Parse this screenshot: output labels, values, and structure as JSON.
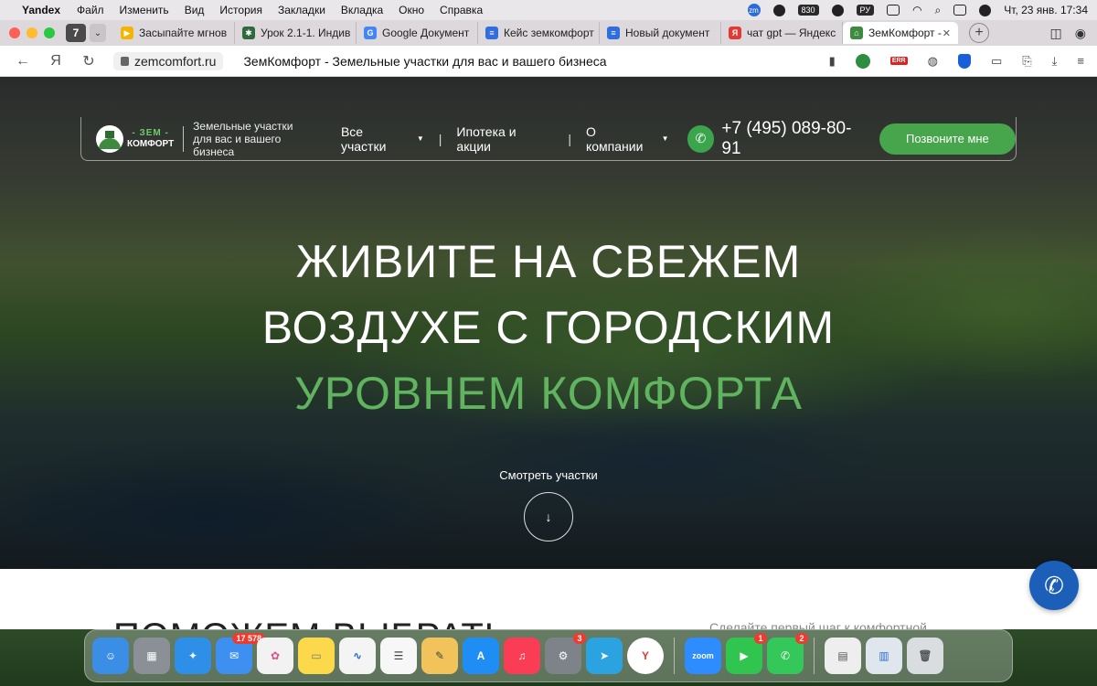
{
  "menubar": {
    "app": "Yandex",
    "items": [
      "Файл",
      "Изменить",
      "Вид",
      "История",
      "Закладки",
      "Вкладка",
      "Окно",
      "Справка"
    ],
    "zoom_badge": "zm",
    "battery_badge": "830",
    "lang": "РУ",
    "datetime": "Чт, 23 янв.  17:34"
  },
  "browser": {
    "tab_count": "7",
    "tabs": [
      {
        "label": "Засыпайте мгнов",
        "fav_color": "#f5b400",
        "fav_glyph": "▶"
      },
      {
        "label": "Урок 2.1-1. Индив",
        "fav_color": "#2f6b3a",
        "fav_glyph": "✱"
      },
      {
        "label": "Google Документ",
        "fav_color": "#4285f4",
        "fav_glyph": "G"
      },
      {
        "label": "Кейс земкомфорт",
        "fav_color": "#2f6ee0",
        "fav_glyph": "≡"
      },
      {
        "label": "Новый документ",
        "fav_color": "#2f6ee0",
        "fav_glyph": "≡"
      },
      {
        "label": "чат gpt — Яндекс",
        "fav_color": "#e53935",
        "fav_glyph": "Я"
      },
      {
        "label": "ЗемКомфорт -",
        "fav_color": "#3e8a3e",
        "fav_glyph": "⌂"
      }
    ],
    "url": "zemcomfort.ru",
    "page_title": "ЗемКомфорт - Земельные участки для вас и вашего бизнеса",
    "err_badge": "ERR"
  },
  "site": {
    "logo_top": "- ЗЕМ -",
    "logo_bottom": "КОМФОРТ",
    "tagline_1": "Земельные участки",
    "tagline_2": "для вас и вашего бизнеса",
    "menu": [
      "Все участки",
      "Ипотека и акции",
      "О компании"
    ],
    "phone": "+7 (495) 089-80-91",
    "call_button": "Позвоните мне",
    "headline_1": "ЖИВИТЕ НА СВЕЖЕМ",
    "headline_2": "ВОЗДУХЕ С ГОРОДСКИМ",
    "headline_3": "УРОВНЕМ КОМФОРТА",
    "see_plots": "Смотреть участки",
    "section_title": "ПОМОЖЕМ ВЫБРАТЬ",
    "section_side": "Сделайте первый шаг к комфортной"
  },
  "dock": {
    "apps": [
      {
        "name": "finder",
        "color": "#3a8ee6",
        "glyph": "☺"
      },
      {
        "name": "launchpad",
        "color": "#8b8f96",
        "glyph": "▦"
      },
      {
        "name": "safari",
        "color": "#2e8fe8",
        "glyph": "✦"
      },
      {
        "name": "mail",
        "color": "#3d8ff0",
        "glyph": "✉",
        "badge": "17 578"
      },
      {
        "name": "photos",
        "color": "#f2f2f2",
        "glyph": "✿"
      },
      {
        "name": "notes",
        "color": "#fcd94a",
        "glyph": "▭"
      },
      {
        "name": "freeform",
        "color": "#f4f4f4",
        "glyph": "∿"
      },
      {
        "name": "reminders",
        "color": "#f7f7f7",
        "glyph": "☰"
      },
      {
        "name": "pages",
        "color": "#f1c35a",
        "glyph": "✎"
      },
      {
        "name": "app-store",
        "color": "#1e8ef5",
        "glyph": "A"
      },
      {
        "name": "music",
        "color": "#fa3d55",
        "glyph": "♫"
      },
      {
        "name": "system-settings",
        "color": "#7e8289",
        "glyph": "⚙",
        "badge": "3"
      },
      {
        "name": "telegram",
        "color": "#2aa3e0",
        "glyph": "➤"
      },
      {
        "name": "yandex-browser",
        "color": "#ffffff",
        "glyph": "Y"
      }
    ],
    "apps_right": [
      {
        "name": "zoom",
        "color": "#2d8cff",
        "glyph": "zoom"
      },
      {
        "name": "facetime",
        "color": "#2fc54f",
        "glyph": "▶",
        "badge": "1"
      },
      {
        "name": "messages",
        "color": "#34c759",
        "glyph": "✆",
        "badge": "2"
      }
    ],
    "apps_files": [
      {
        "name": "document-stack",
        "color": "#eeeeee",
        "glyph": "▤"
      },
      {
        "name": "downloads-stack",
        "color": "#dfe6ee",
        "glyph": "▥"
      },
      {
        "name": "trash",
        "color": "#d9dde0",
        "glyph": "🗑"
      }
    ]
  }
}
